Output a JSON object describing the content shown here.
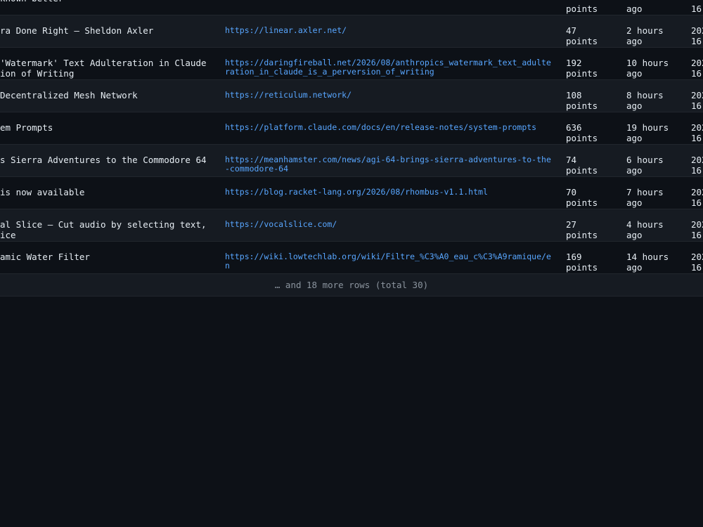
{
  "rows": [
    {
      "title": "known better”",
      "url": "",
      "points": [
        "",
        "points"
      ],
      "ago": [
        "",
        "ago"
      ],
      "date": [
        "",
        "16"
      ]
    },
    {
      "title": "ra Done Right – Sheldon Axler",
      "url": "https://linear.axler.net/",
      "points": [
        "47",
        "points"
      ],
      "ago": [
        "2 hours",
        "ago"
      ],
      "date": [
        "202",
        "16"
      ]
    },
    {
      "title": "'Watermark' Text Adulteration in Claude\nion of Writing",
      "url": "https://daringfireball.net/2026/08/anthropics_watermark_text_adulteration_in_claude_is_a_perversion_of_writing",
      "points": [
        "192",
        "points"
      ],
      "ago": [
        "10 hours",
        "ago"
      ],
      "date": [
        "202",
        "16"
      ]
    },
    {
      "title": "Decentralized Mesh Network",
      "url": "https://reticulum.network/",
      "points": [
        "108",
        "points"
      ],
      "ago": [
        "8 hours",
        "ago"
      ],
      "date": [
        "202",
        "16"
      ]
    },
    {
      "title": "em Prompts",
      "url": "https://platform.claude.com/docs/en/release-notes/system-prompts",
      "points": [
        "636",
        "points"
      ],
      "ago": [
        "19 hours",
        "ago"
      ],
      "date": [
        "202",
        "16"
      ]
    },
    {
      "title": "s Sierra Adventures to the Commodore 64",
      "url": "https://meanhamster.com/news/agi-64-brings-sierra-adventures-to-the-commodore-64",
      "points": [
        "74",
        "points"
      ],
      "ago": [
        "6 hours",
        "ago"
      ],
      "date": [
        "202",
        "16"
      ]
    },
    {
      "title": "is now available",
      "url": "https://blog.racket-lang.org/2026/08/rhombus-v1.1.html",
      "points": [
        "70",
        "points"
      ],
      "ago": [
        "7 hours",
        "ago"
      ],
      "date": [
        "202",
        "16"
      ]
    },
    {
      "title": "al Slice – Cut audio by selecting text,\nice",
      "url": "https://vocalslice.com/",
      "points": [
        "27",
        "points"
      ],
      "ago": [
        "4 hours",
        "ago"
      ],
      "date": [
        "202",
        "16"
      ]
    },
    {
      "title": "amic Water Filter",
      "url": "https://wiki.lowtechlab.org/wiki/Filtre_%C3%A0_eau_c%C3%A9ramique/en",
      "points": [
        "169",
        "points"
      ],
      "ago": [
        "14 hours",
        "ago"
      ],
      "date": [
        "202",
        "16"
      ]
    }
  ],
  "footer": "… and 18 more rows (total 30)"
}
